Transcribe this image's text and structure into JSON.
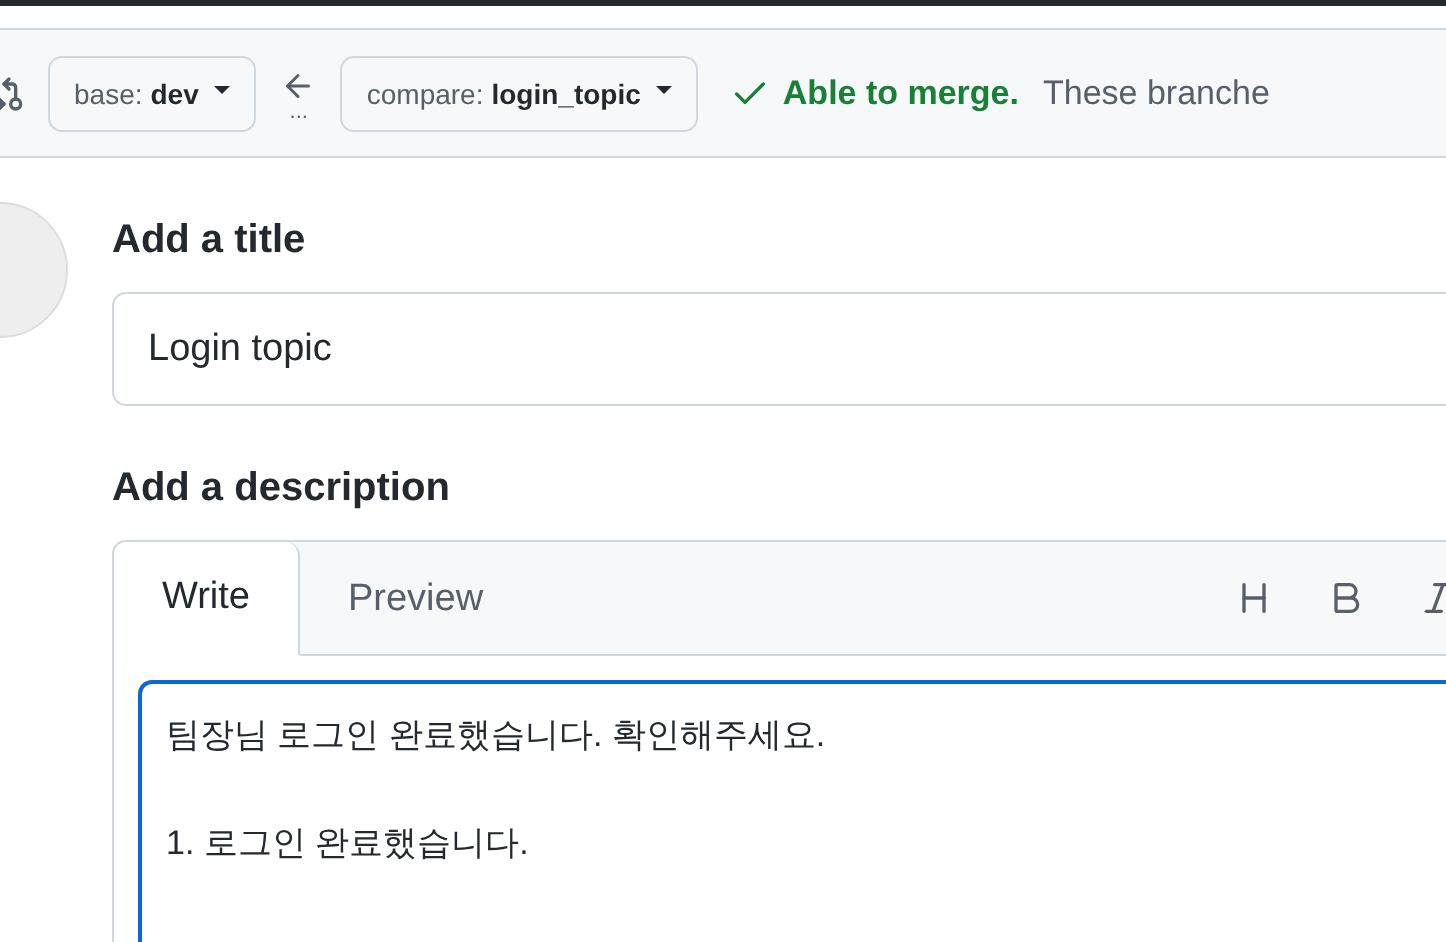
{
  "compare_bar": {
    "base": {
      "label": "base:",
      "branch": "dev"
    },
    "compare": {
      "label": "compare:",
      "branch": "login_topic"
    },
    "dots": "...",
    "merge_status": {
      "title": "Able to merge.",
      "text": "These branche"
    }
  },
  "form": {
    "title_label": "Add a title",
    "title_value": "Login topic",
    "description_label": "Add a description",
    "tabs": [
      {
        "label": "Write",
        "selected": true
      },
      {
        "label": "Preview",
        "selected": false
      }
    ],
    "body": "팀장님 로그인 완료했습니다. 확인해주세요.\n\n1. 로그인 완료했습니다."
  }
}
